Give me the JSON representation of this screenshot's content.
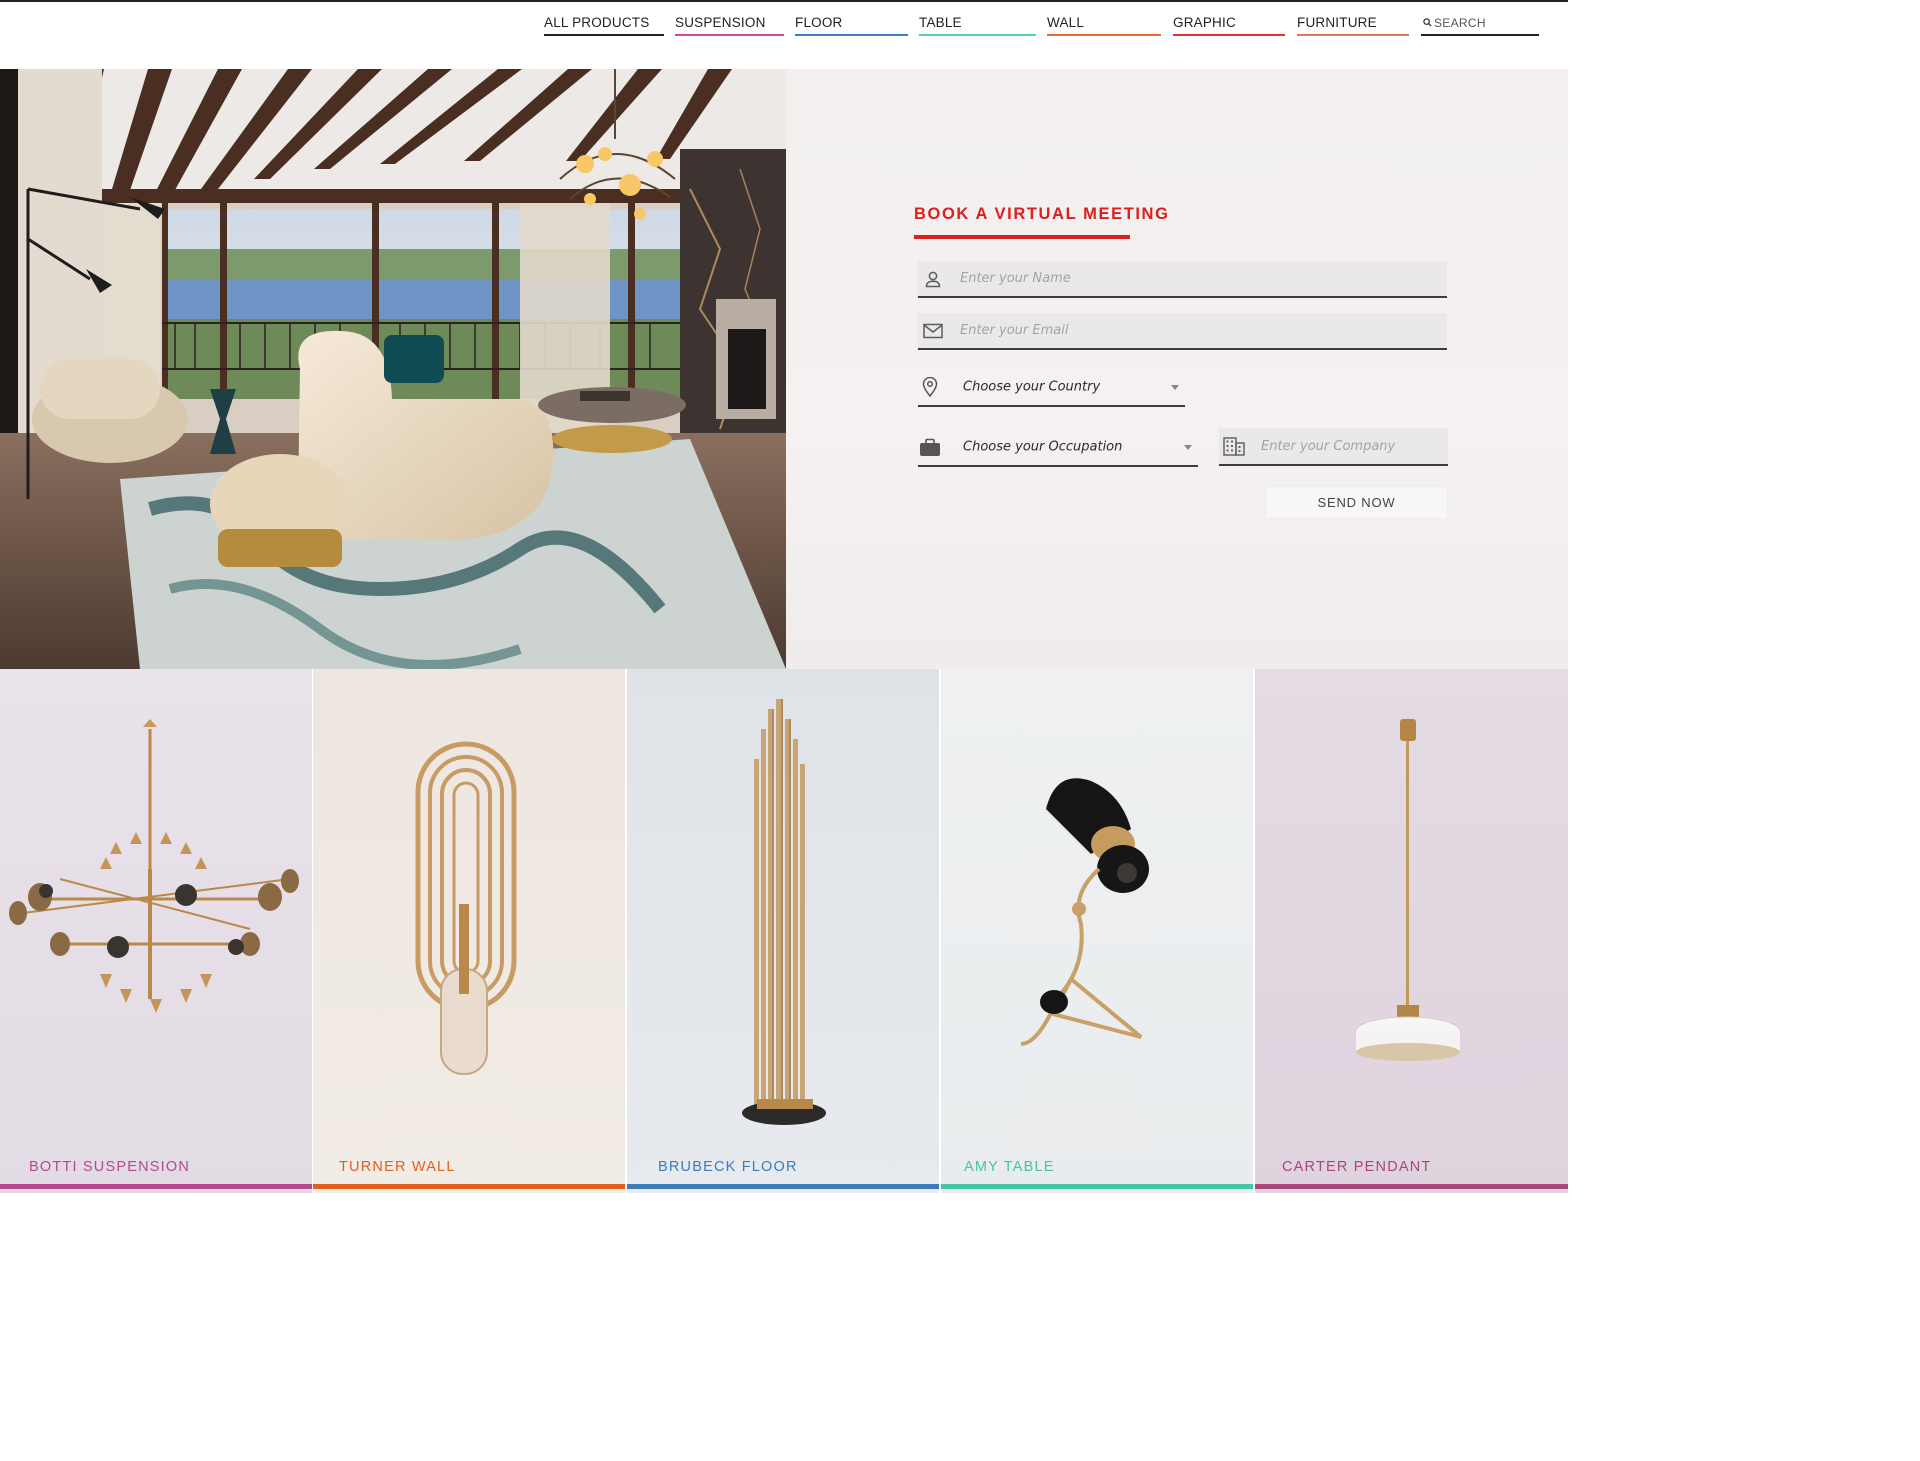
{
  "nav": {
    "items": [
      {
        "label": "ALL PRODUCTS",
        "color": "#222222"
      },
      {
        "label": "SUSPENSION",
        "color": "#d1479f"
      },
      {
        "label": "FLOOR",
        "color": "#3d7fc1"
      },
      {
        "label": "TABLE",
        "color": "#53d1b6"
      },
      {
        "label": "WALL",
        "color": "#ee6a2c"
      },
      {
        "label": "GRAPHIC",
        "color": "#e5303a"
      },
      {
        "label": "FURNITURE",
        "color": "#e07761"
      }
    ],
    "search_placeholder": "SEARCH"
  },
  "form": {
    "title": "BOOK A VIRTUAL MEETING",
    "accent_color": "#d9201c",
    "name_placeholder": "Enter your Name",
    "email_placeholder": "Enter your Email",
    "country_value": "Choose your Country",
    "occupation_value": "Choose your Occupation",
    "company_placeholder": "Enter your Company",
    "submit_label": "SEND NOW"
  },
  "products": [
    {
      "name": "BOTTI SUSPENSION",
      "color": "#b5488f"
    },
    {
      "name": "TURNER WALL",
      "color": "#e35d1c"
    },
    {
      "name": "BRUBECK FLOOR",
      "color": "#3c7cb8"
    },
    {
      "name": "AMY TABLE",
      "color": "#46c4a6"
    },
    {
      "name": "CARTER PENDANT",
      "color": "#a8477d"
    }
  ]
}
